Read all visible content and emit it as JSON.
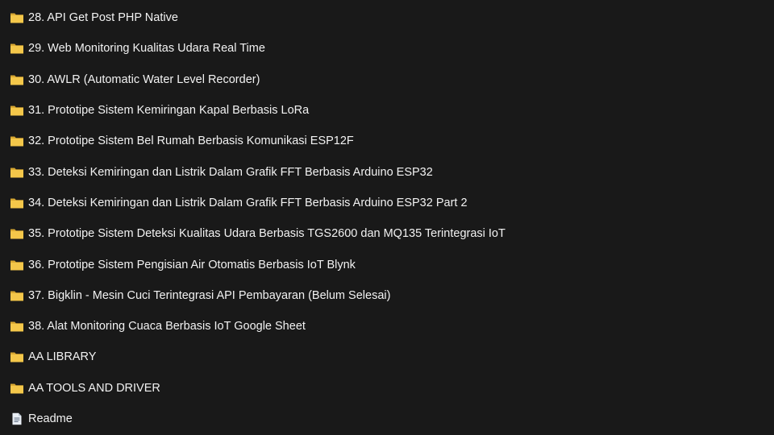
{
  "items": [
    {
      "type": "folder",
      "icon": "folder-icon",
      "label": "28. API Get Post PHP Native"
    },
    {
      "type": "folder",
      "icon": "folder-icon",
      "label": "29. Web Monitoring Kualitas Udara Real Time"
    },
    {
      "type": "folder",
      "icon": "folder-icon",
      "label": "30. AWLR (Automatic Water Level Recorder)"
    },
    {
      "type": "folder",
      "icon": "folder-icon",
      "label": "31. Prototipe Sistem Kemiringan Kapal Berbasis LoRa"
    },
    {
      "type": "folder",
      "icon": "folder-icon",
      "label": "32. Prototipe Sistem Bel Rumah Berbasis Komunikasi ESP12F"
    },
    {
      "type": "folder",
      "icon": "folder-icon",
      "label": "33. Deteksi Kemiringan dan Listrik Dalam Grafik FFT Berbasis Arduino ESP32"
    },
    {
      "type": "folder",
      "icon": "folder-icon",
      "label": "34. Deteksi Kemiringan dan Listrik Dalam Grafik FFT Berbasis Arduino ESP32 Part 2"
    },
    {
      "type": "folder",
      "icon": "folder-icon",
      "label": "35. Prototipe Sistem Deteksi Kualitas Udara Berbasis TGS2600 dan MQ135 Terintegrasi IoT"
    },
    {
      "type": "folder",
      "icon": "folder-icon",
      "label": "36. Prototipe Sistem Pengisian Air Otomatis Berbasis IoT Blynk"
    },
    {
      "type": "folder",
      "icon": "folder-icon",
      "label": "37. Bigklin - Mesin Cuci Terintegrasi API Pembayaran (Belum Selesai)"
    },
    {
      "type": "folder",
      "icon": "folder-icon",
      "label": "38. Alat Monitoring Cuaca Berbasis IoT Google Sheet"
    },
    {
      "type": "folder",
      "icon": "folder-icon",
      "label": "AA LIBRARY"
    },
    {
      "type": "folder",
      "icon": "folder-icon",
      "label": "AA TOOLS AND DRIVER"
    },
    {
      "type": "file",
      "icon": "text-document-icon",
      "label": "Readme"
    }
  ],
  "colors": {
    "background": "#191919",
    "text": "#f2f2f2",
    "folder": "#f4c74a",
    "folder_dark": "#d8a832",
    "document": "#e9eef5"
  }
}
